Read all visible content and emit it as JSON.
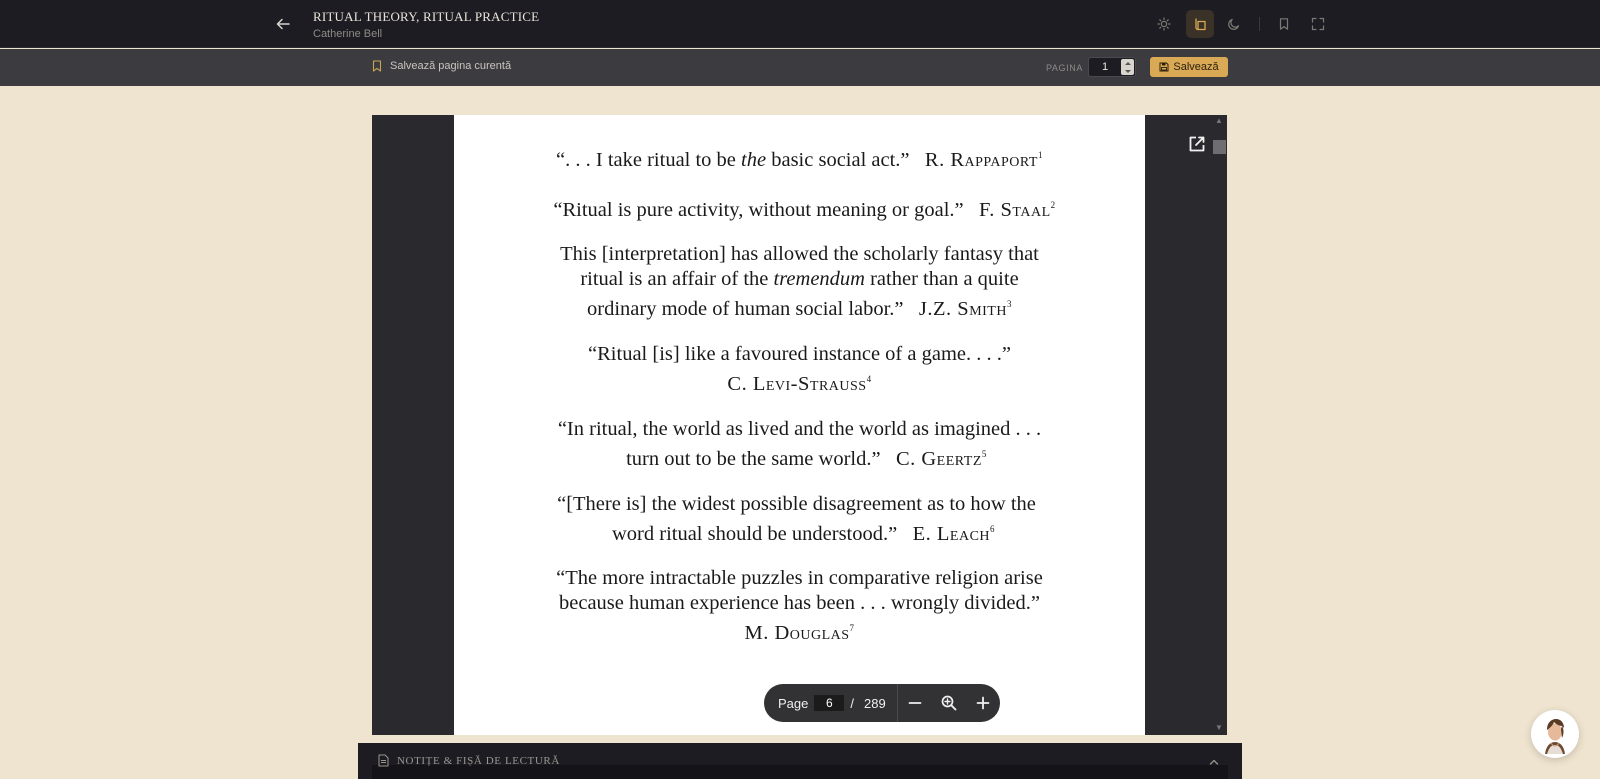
{
  "header": {
    "title": "RITUAL THEORY, RITUAL PRACTICE",
    "author": "Catherine Bell",
    "icons": [
      "arrow-left-icon",
      "sun-icon",
      "reading-mode-icon",
      "moon-icon",
      "bookmark-icon",
      "fullscreen-icon"
    ]
  },
  "pagebar": {
    "save_current_label": "Salvează pagina curentă",
    "page_label": "PAGINA",
    "page_value": "1",
    "save_button": "Salvează"
  },
  "document": {
    "q1": {
      "pre": "“. . . I take ritual to be ",
      "em": "the",
      "post": " basic social act.”",
      "author": "R. Rappaport",
      "note": "1"
    },
    "q2": {
      "text": "“Ritual is pure activity, without meaning or goal.”",
      "author": "F. Staal",
      "note": "2"
    },
    "q3": {
      "line1": "This [interpretation] has allowed the scholarly fantasy that",
      "pre": "ritual is an affair of the ",
      "em": "tremendum",
      "post": " rather than a quite",
      "line3": "ordinary mode of human social labor.”",
      "author": "J.Z. Smith",
      "note": "3"
    },
    "q4": {
      "line1": "“Ritual [is] like a favoured instance of a game. . . .”",
      "author": "C. Levi-Strauss",
      "note": "4"
    },
    "q5": {
      "line1": "“In ritual, the world as lived and the world as imagined . . .",
      "line2": "turn out to be the same world.”",
      "author": "C. Geertz",
      "note": "5"
    },
    "q6": {
      "line1": "“[There is] the widest possible disagreement as to how the",
      "line2": "word ritual should be understood.”",
      "author": "E. Leach",
      "note": "6"
    },
    "q7": {
      "line1": "“The more intractable puzzles in comparative religion arise",
      "line2": "because human experience has been . . . wrongly divided.”",
      "author": "M. Douglas",
      "note": "7"
    }
  },
  "pdf_toolbar": {
    "page_label": "Page",
    "current_page": "6",
    "separator": "/",
    "total_pages": "289"
  },
  "notes": {
    "label": "NOTIȚE & FIȘĂ DE LECTURĂ"
  },
  "colors": {
    "topbar": "#1d1c22",
    "pagebar": "#3c3b40",
    "background": "#efe4cf",
    "accent": "#d9a955"
  }
}
